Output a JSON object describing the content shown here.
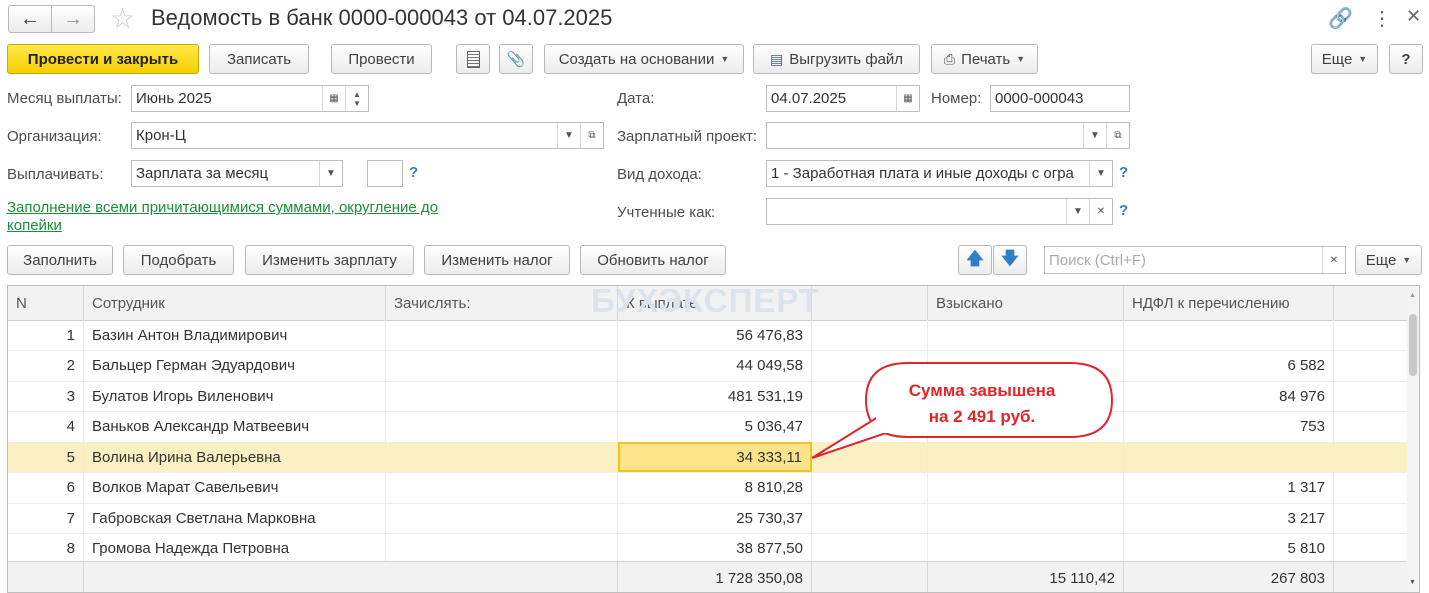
{
  "window": {
    "title": "Ведомость в банк 0000-000043 от 04.07.2025"
  },
  "toolbar": {
    "post_close": "Провести и закрыть",
    "save": "Записать",
    "post": "Провести",
    "create_based": "Создать на основании",
    "export_file": "Выгрузить файл",
    "print": "Печать",
    "more": "Еще",
    "help": "?"
  },
  "form": {
    "month_label": "Месяц выплаты:",
    "month_value": "Июнь 2025",
    "date_label": "Дата:",
    "date_value": "04.07.2025",
    "number_label": "Номер:",
    "number_value": "0000-000043",
    "org_label": "Организация:",
    "org_value": "Крон-Ц",
    "salary_project_label": "Зарплатный проект:",
    "salary_project_value": "",
    "pay_label": "Выплачивать:",
    "pay_value": "Зарплата за месяц",
    "help": "?",
    "income_type_label": "Вид дохода:",
    "income_type_value": "1 - Заработная плата и иные доходы с огра",
    "accounted_label": "Учтенные как:",
    "accounted_value": "",
    "fill_link_line1": "Заполнение всеми причитающимися суммами, округление до",
    "fill_link_line2": "копейки"
  },
  "table_toolbar": {
    "fill": "Заполнить",
    "pick": "Подобрать",
    "change_salary": "Изменить зарплату",
    "change_tax": "Изменить налог",
    "update_tax": "Обновить налог",
    "search_placeholder": "Поиск (Ctrl+F)",
    "more": "Еще"
  },
  "table": {
    "columns": [
      "N",
      "Сотрудник",
      "Зачислять:",
      "К выплате",
      "Взыскано",
      "НДФЛ к перечислению"
    ],
    "rows": [
      {
        "n": "1",
        "employee": "Базин Антон Владимирович",
        "credit": "",
        "pay": "56 476,83",
        "recovered": "",
        "ndfl": ""
      },
      {
        "n": "2",
        "employee": "Бальцер Герман Эдуардович",
        "credit": "",
        "pay": "44 049,58",
        "recovered": "",
        "ndfl": "6 582"
      },
      {
        "n": "3",
        "employee": "Булатов Игорь Виленович",
        "credit": "",
        "pay": "481 531,19",
        "recovered": "",
        "ndfl": "84 976"
      },
      {
        "n": "4",
        "employee": "Ваньков Александр Матвеевич",
        "credit": "",
        "pay": "5 036,47",
        "recovered": "",
        "ndfl": "753"
      },
      {
        "n": "5",
        "employee": "Волина Ирина Валерьевна",
        "credit": "",
        "pay": "34 333,11",
        "recovered": "",
        "ndfl": ""
      },
      {
        "n": "6",
        "employee": "Волков Марат Савельевич",
        "credit": "",
        "pay": "8 810,28",
        "recovered": "",
        "ndfl": "1 317"
      },
      {
        "n": "7",
        "employee": "Габровская Светлана Марковна",
        "credit": "",
        "pay": "25 730,37",
        "recovered": "",
        "ndfl": "3 217"
      },
      {
        "n": "8",
        "employee": "Громова Надежда Петровна",
        "credit": "",
        "pay": "38 877,50",
        "recovered": "",
        "ndfl": "5 810"
      }
    ],
    "totals": {
      "pay": "1 728 350,08",
      "recovered": "15 110,42",
      "ndfl": "267 803"
    }
  },
  "callout": {
    "line1": "Сумма завышена",
    "line2": "на 2 491 руб."
  },
  "watermark": "БУХЭКСПЕРТ",
  "colors": {
    "primary_button": "#f5d000",
    "link": "#1b8f3a",
    "help": "#2f7ec9",
    "callout": "#e0262b",
    "selected_row": "#fbf0c3"
  }
}
